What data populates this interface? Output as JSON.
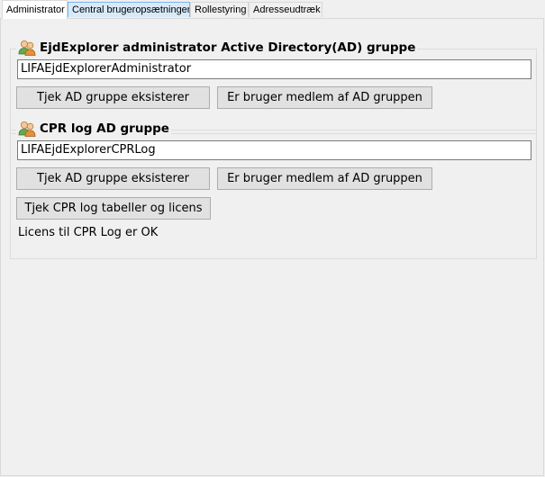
{
  "tabs": [
    {
      "label": "Administrator"
    },
    {
      "label": "Central brugeropsætninger"
    },
    {
      "label": "Rollestyring"
    },
    {
      "label": "Adresseudtræk"
    }
  ],
  "admin_group": {
    "title": "EjdExplorer administrator Active Directory(AD) gruppe",
    "group_name_value": "LIFAEjdExplorerAdministrator",
    "check_exists_label": "Tjek AD gruppe eksisterer",
    "check_member_label": "Er bruger medlem af AD gruppen"
  },
  "cpr_group": {
    "title": "CPR log AD gruppe",
    "group_name_value": "LIFAEjdExplorerCPRLog",
    "check_exists_label": "Tjek AD gruppe eksisterer",
    "check_member_label": "Er bruger medlem af AD gruppen",
    "check_tables_label": "Tjek CPR log tabeller og licens",
    "license_status": "Licens til CPR Log er OK"
  },
  "icons": {
    "group_icon": "users-icon"
  }
}
